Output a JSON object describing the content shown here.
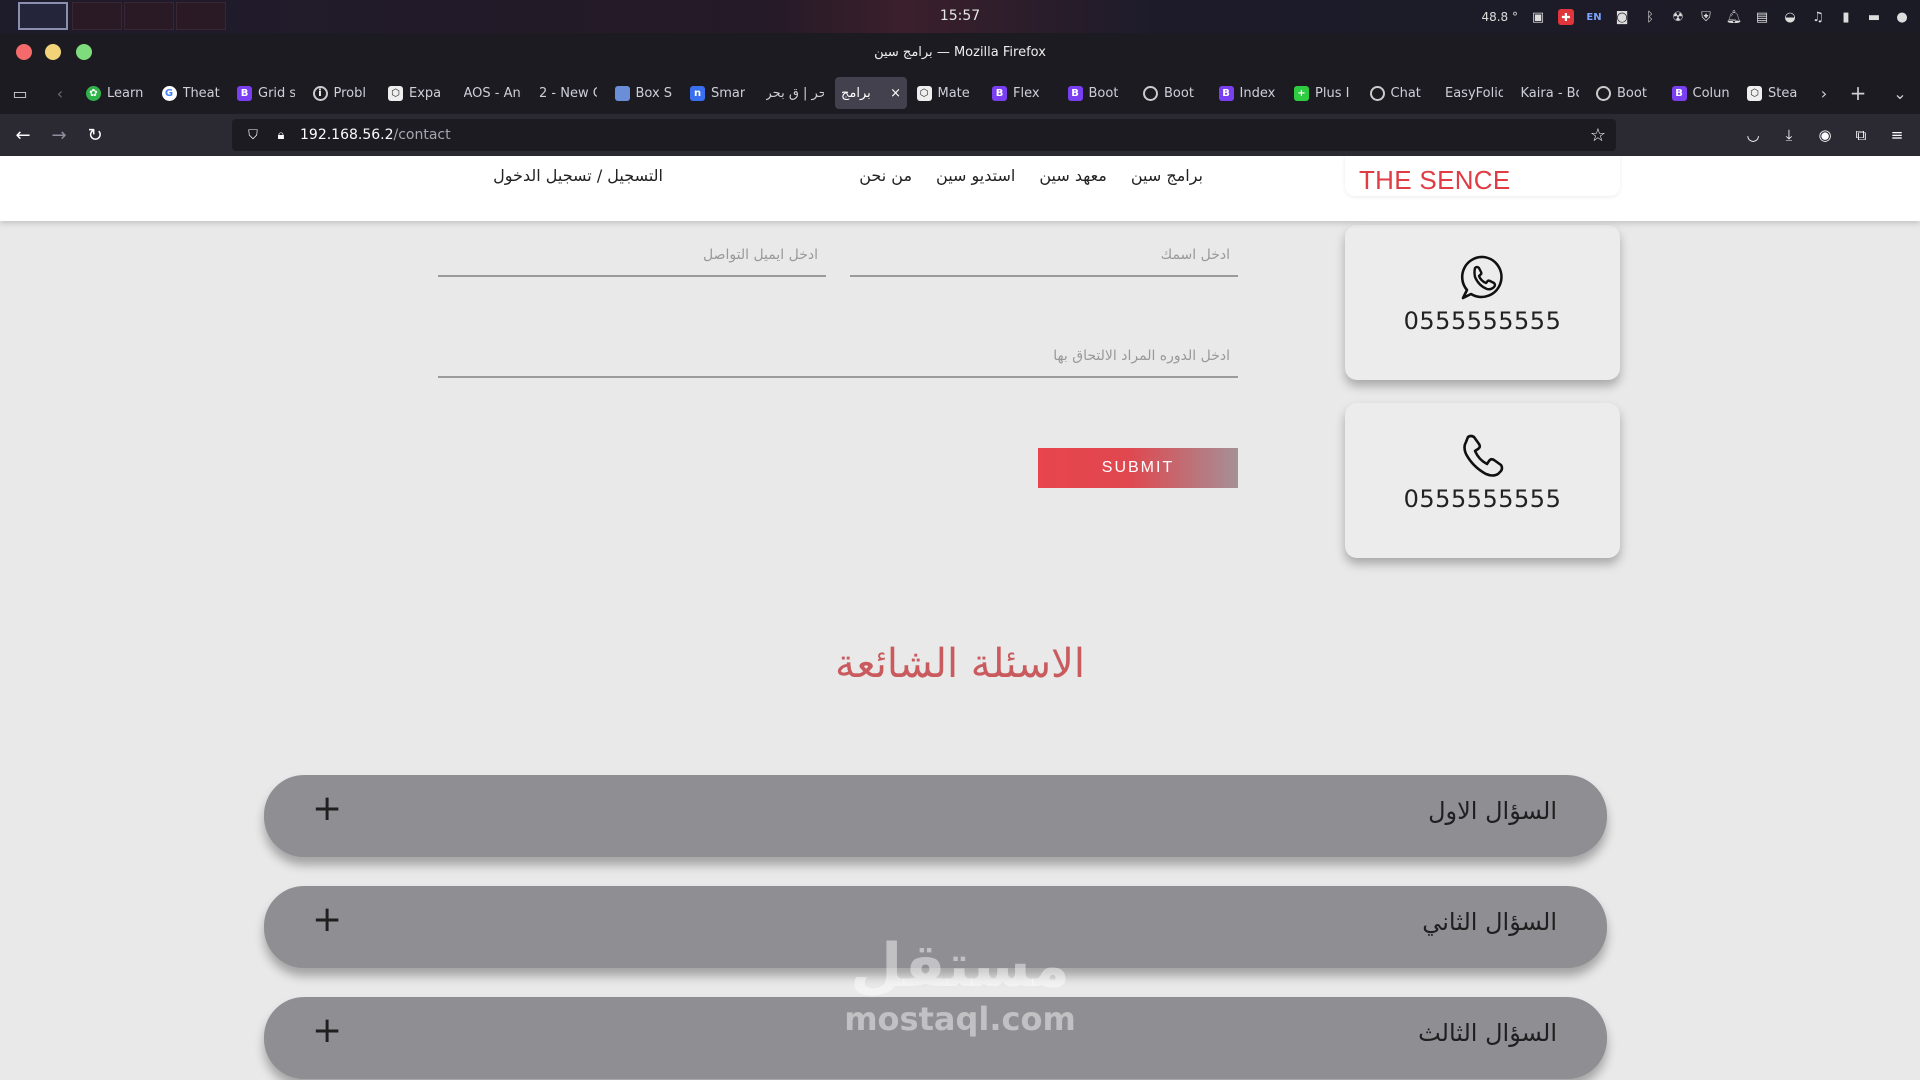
{
  "system": {
    "clock": "15:57",
    "temperature": "48.8 °",
    "lang": "EN"
  },
  "window": {
    "title": "برامج سين — Mozilla Firefox"
  },
  "tabs": [
    {
      "label": "Learn",
      "icon": "plant-icon",
      "active": false
    },
    {
      "label": "Theat",
      "icon": "google-icon",
      "active": false
    },
    {
      "label": "Grid s",
      "icon": "bootstrap-icon",
      "active": false
    },
    {
      "label": "Probl",
      "icon": "info-icon",
      "active": false
    },
    {
      "label": "Expa",
      "icon": "hex-icon",
      "active": false
    },
    {
      "label": "AOS - Ani",
      "icon": "",
      "active": false
    },
    {
      "label": "2 - New C",
      "icon": "",
      "active": false
    },
    {
      "label": "Box S",
      "icon": "box-icon",
      "active": false
    },
    {
      "label": "Smar",
      "icon": "n-icon",
      "active": false
    },
    {
      "label": "بحر | ق بحر",
      "icon": "",
      "active": false
    },
    {
      "label": "برامج",
      "icon": "",
      "active": true
    },
    {
      "label": "Mate",
      "icon": "hex-icon",
      "active": false
    },
    {
      "label": "Flex",
      "icon": "bootstrap-icon",
      "active": false
    },
    {
      "label": "Boot",
      "icon": "bootstrap-icon",
      "active": false
    },
    {
      "label": "Boot",
      "icon": "globe-icon",
      "active": false
    },
    {
      "label": "Index",
      "icon": "bootstrap-icon",
      "active": false
    },
    {
      "label": "Plus I",
      "icon": "plus-icon",
      "active": false
    },
    {
      "label": "Chat",
      "icon": "openai-icon",
      "active": false
    },
    {
      "label": "EasyFolio",
      "icon": "",
      "active": false
    },
    {
      "label": "Kaira - Bo",
      "icon": "",
      "active": false
    },
    {
      "label": "Boot",
      "icon": "globe-icon",
      "active": false
    },
    {
      "label": "Colun",
      "icon": "bootstrap-icon",
      "active": false
    },
    {
      "label": "Stea",
      "icon": "hex-icon",
      "active": false
    }
  ],
  "urlbar": {
    "host": "192.168.56.2",
    "path": "/contact"
  },
  "site": {
    "brand": "THE SENCE",
    "nav": [
      "برامج سين",
      "معهد سين",
      "استديو سين",
      "من نحن"
    ],
    "auth": "التسجيل / تسجيل الدخول"
  },
  "form": {
    "name_placeholder": "ادخل اسمك",
    "email_placeholder": "ادخل ايميل التواصل",
    "course_placeholder": "ادخل الدوره المراد الالتحاق بها",
    "submit": "SUBMIT"
  },
  "contacts": [
    {
      "icon": "whatsapp-icon",
      "number": "0555555555"
    },
    {
      "icon": "phone-icon",
      "number": "0555555555"
    }
  ],
  "faq": {
    "title": "الاسئلة الشائعة",
    "items": [
      "السؤال الاول",
      "السؤال الثاني",
      "السؤال الثالث"
    ],
    "toggle": "+"
  },
  "watermark": {
    "arabic": "مستقل",
    "latin": "mostaql.com"
  }
}
